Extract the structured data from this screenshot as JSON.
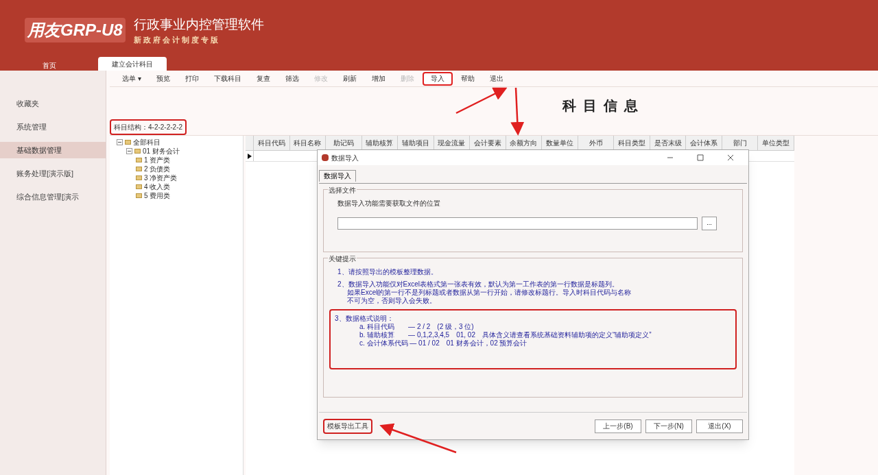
{
  "header": {
    "logo": "用友GRP-U8",
    "title": "行政事业内控管理软件",
    "subtitle": "新政府会计制度专版"
  },
  "tabs": [
    {
      "label": "首页",
      "selected": false
    },
    {
      "label": "建立会计科目",
      "selected": true
    }
  ],
  "sidebar": [
    {
      "label": "收藏夹",
      "selected": false
    },
    {
      "label": "系统管理",
      "selected": false
    },
    {
      "label": "基础数据管理",
      "selected": true
    },
    {
      "label": "账务处理[演示版]",
      "selected": false
    },
    {
      "label": "综合信息管理[演示",
      "selected": false
    }
  ],
  "toolbar": [
    {
      "label": "选单 ▾",
      "disabled": false,
      "highlighted": false
    },
    {
      "label": "预览",
      "disabled": false,
      "highlighted": false
    },
    {
      "label": "打印",
      "disabled": false,
      "highlighted": false
    },
    {
      "label": "下载科目",
      "disabled": false,
      "highlighted": false
    },
    {
      "label": "复查",
      "disabled": false,
      "highlighted": false
    },
    {
      "label": "筛选",
      "disabled": false,
      "highlighted": false
    },
    {
      "label": "修改",
      "disabled": true,
      "highlighted": false
    },
    {
      "label": "刷新",
      "disabled": false,
      "highlighted": false
    },
    {
      "label": "增加",
      "disabled": false,
      "highlighted": false
    },
    {
      "label": "删除",
      "disabled": true,
      "highlighted": false
    },
    {
      "label": "导入",
      "disabled": false,
      "highlighted": true
    },
    {
      "label": "帮助",
      "disabled": false,
      "highlighted": false
    },
    {
      "label": "退出",
      "disabled": false,
      "highlighted": false
    }
  ],
  "page_title": "科目信息",
  "subject_structure": {
    "text": "科目结构：4-2-2-2-2-2",
    "highlighted": true
  },
  "tree": [
    {
      "label": "全部科目",
      "expanded": true,
      "children": [
        {
          "label": "01 财务会计",
          "expanded": true,
          "children": [
            {
              "label": "1 资产类"
            },
            {
              "label": "2 负债类"
            },
            {
              "label": "3 净资产类"
            },
            {
              "label": "4 收入类"
            },
            {
              "label": "5 费用类"
            }
          ]
        }
      ]
    }
  ],
  "grid": {
    "columns": [
      "科目代码",
      "科目名称",
      "助记码",
      "辅助核算",
      "辅助项目",
      "现金流量",
      "会计要素",
      "余额方向",
      "数量单位",
      "外币",
      "科目类型",
      "是否末级",
      "会计体系",
      "部门",
      "单位类型"
    ]
  },
  "dialog": {
    "title": "数据导入",
    "tab": "数据导入",
    "file_group": {
      "title": "选择文件",
      "label": "数据导入功能需要获取文件的位置",
      "browse": "..."
    },
    "tips_group": {
      "title": "关键提示",
      "items": [
        {
          "highlighted": false,
          "lines": [
            "1、请按照导出的模板整理数据。"
          ]
        },
        {
          "highlighted": false,
          "lines": [
            "2、数据导入功能仅对Excel表格式第一张表有效，默认为第一工作表的第一行数据是标题列。",
            "如果Excel的第一行不是列标题或者数据从第一行开始，请修改标题行。导入时科目代码与名称",
            "不可为空，否则导入会失败。"
          ]
        },
        {
          "highlighted": true,
          "lines": [
            "3、数据格式说明：",
            "a. 科目代码　　— 2 / 2　(2 级，3 位)",
            "b. 辅助核算　　— 0,1,2,3,4,5　01, 02　具体含义请查看系统基础资料辅助项的定义“辅助项定义”",
            "c. 会计体系代码 — 01 / 02　01 财务会计，02 预算会计"
          ]
        }
      ]
    },
    "template_button": {
      "label": "模板导出工具",
      "highlighted": true
    },
    "buttons": [
      "上一步(B)",
      "下一步(N)",
      "退出(X)"
    ]
  }
}
